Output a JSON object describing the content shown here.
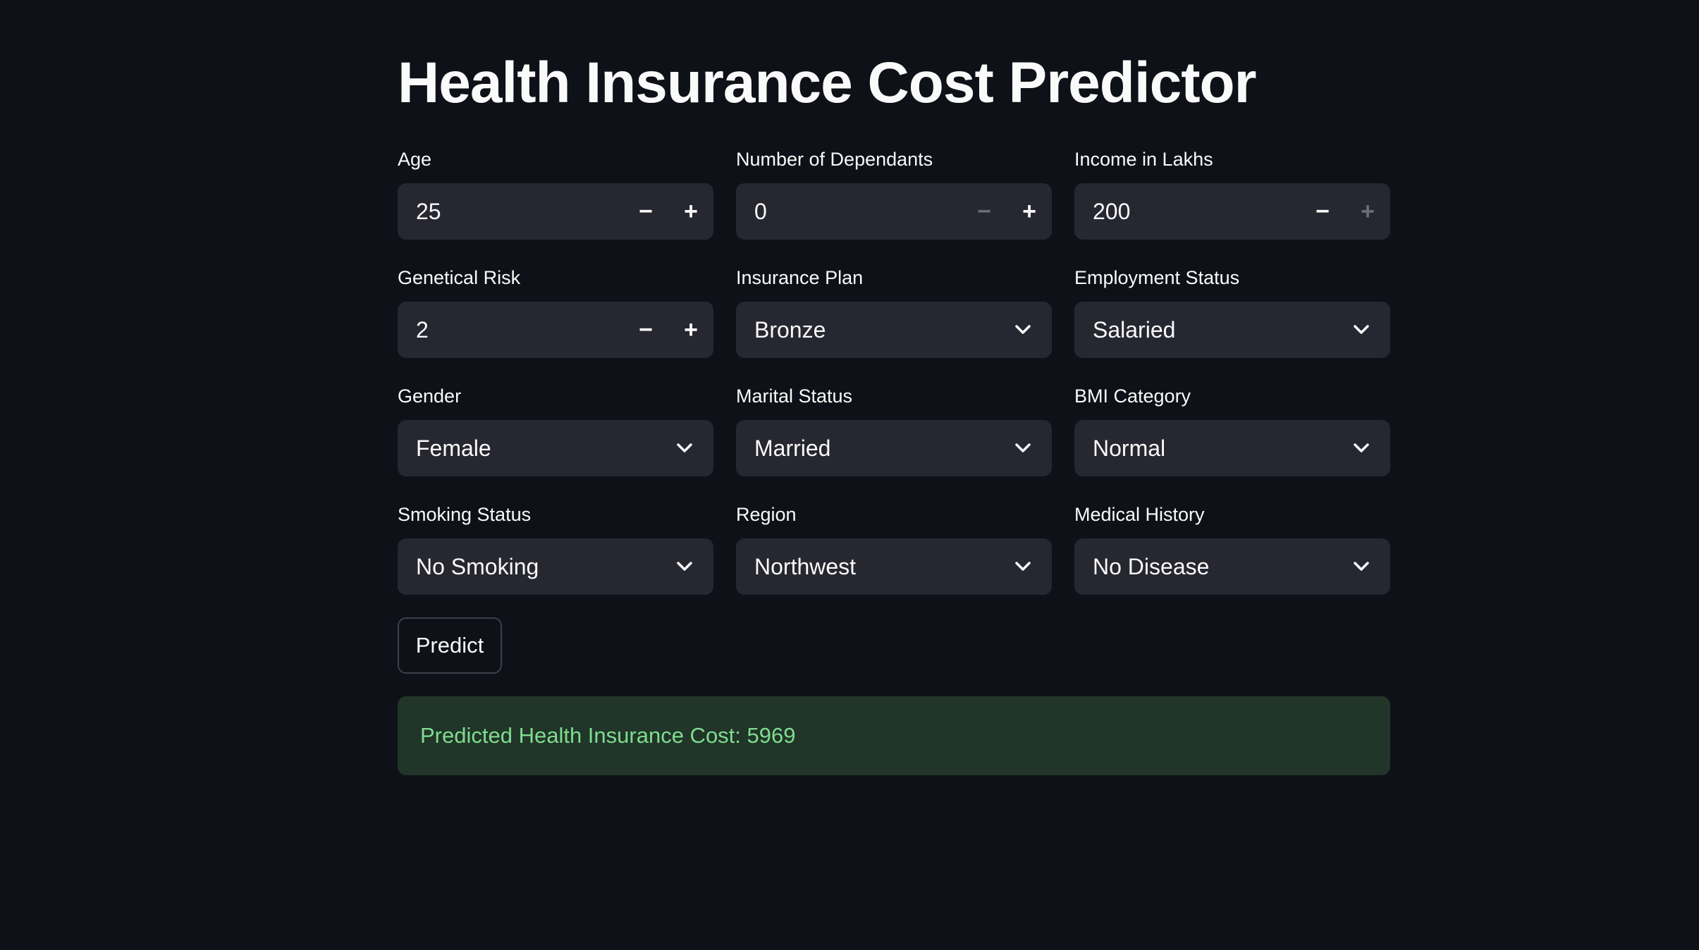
{
  "page": {
    "title": "Health Insurance Cost Predictor"
  },
  "fields": {
    "age": {
      "label": "Age",
      "value": "25"
    },
    "dependants": {
      "label": "Number of Dependants",
      "value": "0"
    },
    "income": {
      "label": "Income in Lakhs",
      "value": "200"
    },
    "genetical_risk": {
      "label": "Genetical Risk",
      "value": "2"
    },
    "insurance_plan": {
      "label": "Insurance Plan",
      "value": "Bronze"
    },
    "employment_status": {
      "label": "Employment Status",
      "value": "Salaried"
    },
    "gender": {
      "label": "Gender",
      "value": "Female"
    },
    "marital_status": {
      "label": "Marital Status",
      "value": "Married"
    },
    "bmi_category": {
      "label": "BMI Category",
      "value": "Normal"
    },
    "smoking_status": {
      "label": "Smoking Status",
      "value": "No Smoking"
    },
    "region": {
      "label": "Region",
      "value": "Northwest"
    },
    "medical_history": {
      "label": "Medical History",
      "value": "No Disease"
    }
  },
  "stepper": {
    "minus": "−",
    "plus": "+"
  },
  "icons": {
    "chevron": "chevron-down-icon"
  },
  "actions": {
    "predict_label": "Predict"
  },
  "result": {
    "text": "Predicted Health Insurance Cost: 5969"
  },
  "colors": {
    "background": "#0e1117",
    "input_bg": "#262730",
    "success_bg": "#213529",
    "success_text": "#7fdc8f"
  }
}
